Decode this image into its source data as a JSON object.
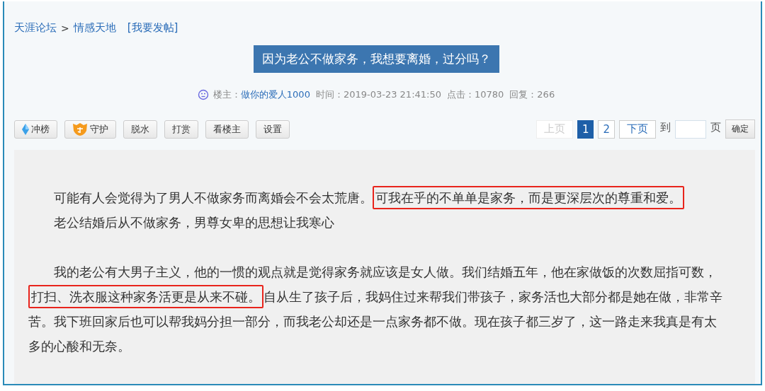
{
  "breadcrumb": {
    "forum": "天涯论坛",
    "separator": ">",
    "board": "情感天地",
    "post_link": "[我要发帖]"
  },
  "title": "因为老公不做家务，我想要离婚，过分吗？",
  "meta": {
    "author_label": "楼主：",
    "author": "做你的爱人1000",
    "time": "时间：2019-03-23 21:41:50",
    "clicks": "点击：10780",
    "replies": "回复：266"
  },
  "toolbar": [
    {
      "label": "冲榜",
      "kind": "diamond"
    },
    {
      "label": "守护",
      "kind": "shield"
    },
    {
      "label": "脱水",
      "kind": "plain"
    },
    {
      "label": "打赏",
      "kind": "plain"
    },
    {
      "label": "看楼主",
      "kind": "plain"
    },
    {
      "label": "设置",
      "kind": "plain"
    }
  ],
  "pagination": {
    "prev": {
      "label": "上页",
      "disabled": true
    },
    "pages": [
      {
        "label": "1",
        "selected": true
      },
      {
        "label": "2",
        "selected": false
      }
    ],
    "next": {
      "label": "下页",
      "disabled": false
    },
    "goto_label": "到",
    "page_unit": "页",
    "confirm": "确定"
  },
  "paragraphs": [
    {
      "segments": [
        {
          "text": "可能有人会觉得为了男人不做家务而离婚会不会太荒唐。",
          "highlighted": false
        },
        {
          "text": "可我在乎的不单单是家务，而是更深层次的尊重和爱。",
          "highlighted": true
        }
      ]
    },
    {
      "segments": [
        {
          "text": "老公结婚后从不做家务，男尊女卑的思想让我寒心",
          "highlighted": false
        }
      ]
    },
    {
      "lines": [
        {
          "segments": [
            {
              "text": "我的老公有大男子主义，他的一惯的观点就是觉得家务就应该是女人做。我们结婚五年，他在家做饭的次数屈指可数，",
              "highlighted": false
            }
          ]
        },
        {
          "segments": [
            {
              "text": "打扫、洗衣服这种家务活更是从来不碰。",
              "highlighted": true
            },
            {
              "text": "自从生了孩子后，我妈住过来帮我们带孩子，家务活也大部分都是她在做，非常辛",
              "highlighted": false
            }
          ]
        },
        {
          "segments": [
            {
              "text": "苦。我下班回家后也可以帮我妈分担一部分，而我老公却还是一点家务都不做。现在孩子都三岁了，这一路走来我真是有太",
              "highlighted": false
            }
          ]
        },
        {
          "segments": [
            {
              "text": "多的心酸和无奈。",
              "highlighted": false
            }
          ]
        }
      ]
    }
  ]
}
